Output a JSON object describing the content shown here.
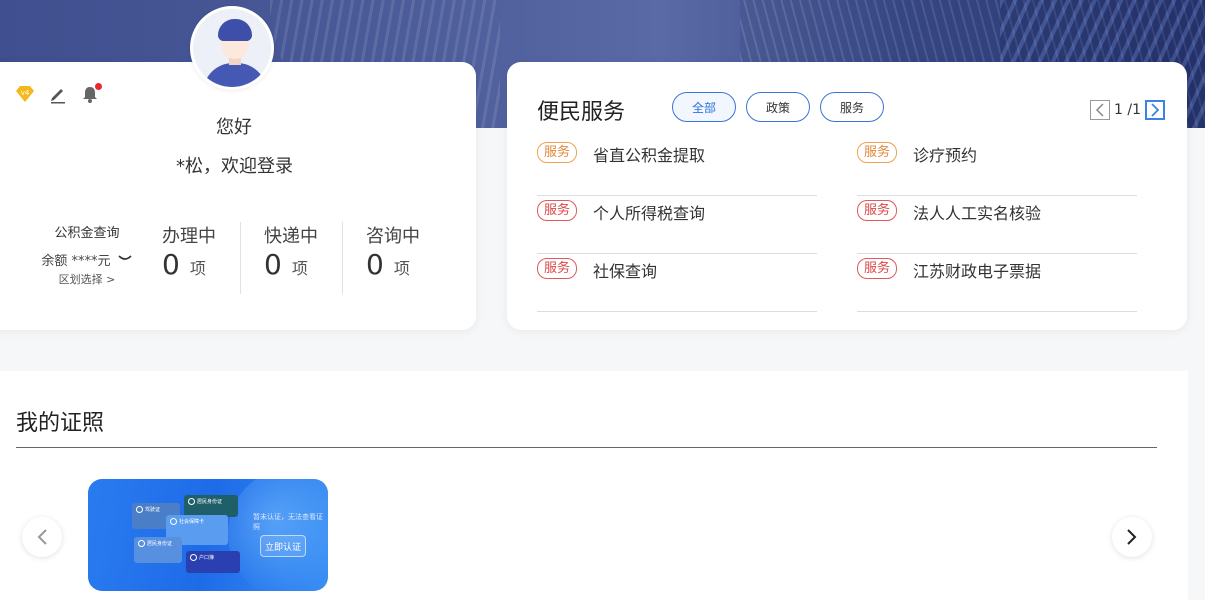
{
  "user": {
    "vip_level": "v4",
    "greeting": "您好",
    "welcome": "*松，欢迎登录",
    "gjj": {
      "title": "公积金查询",
      "balance": "余额 ****元",
      "area": "区划选择 >"
    },
    "stats": [
      {
        "label": "办理中",
        "count": "0",
        "unit": "项"
      },
      {
        "label": "快递中",
        "count": "0",
        "unit": "项"
      },
      {
        "label": "咨询中",
        "count": "0",
        "unit": "项"
      }
    ]
  },
  "services": {
    "title": "便民服务",
    "filters": [
      "全部",
      "政策",
      "服务"
    ],
    "active_filter": "全部",
    "page": "1 /1",
    "items": [
      {
        "tag": "服务",
        "name": "省直公积金提取",
        "tag_color": "#e0883a"
      },
      {
        "tag": "服务",
        "name": "诊疗预约",
        "tag_color": "#e0883a"
      },
      {
        "tag": "服务",
        "name": "个人所得税查询",
        "tag_color": "#d94848"
      },
      {
        "tag": "服务",
        "name": "法人人工实名核验",
        "tag_color": "#d94848"
      },
      {
        "tag": "服务",
        "name": "社保查询",
        "tag_color": "#d94848"
      },
      {
        "tag": "服务",
        "name": "江苏财政电子票据",
        "tag_color": "#d94848"
      }
    ]
  },
  "certificates": {
    "title": "我的证照",
    "banner": {
      "slogan": "暂未认证，无法查看证照",
      "cta": "立即认证",
      "mini_cards": [
        "居民身份证",
        "社会保障卡",
        "驾驶证",
        "户口簿"
      ]
    }
  },
  "colors": {
    "accent": "#3975d6",
    "banner": "#3f4f8f"
  }
}
